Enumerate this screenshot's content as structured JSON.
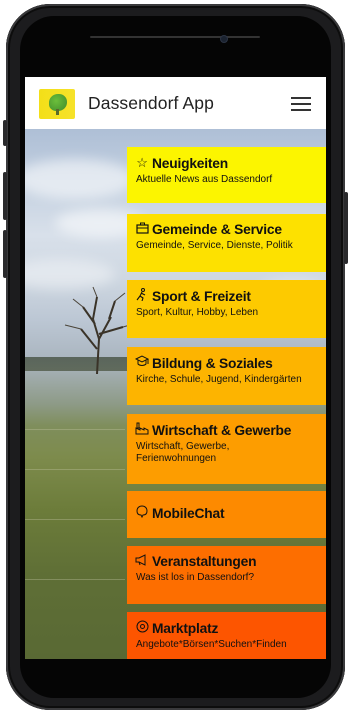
{
  "app": {
    "title": "Dassendorf App"
  },
  "tiles": [
    {
      "title": "Neuigkeiten",
      "subtitle": "Aktuelle News aus Dassendorf",
      "icon": "star-icon",
      "color": "#fcf500"
    },
    {
      "title": "Gemeinde & Service",
      "subtitle": "Gemeinde, Service, Dienste, Politik",
      "icon": "briefcase-icon",
      "color": "#fde100"
    },
    {
      "title": "Sport & Freizeit",
      "subtitle": "Sport, Kultur, Hobby, Leben",
      "icon": "runner-icon",
      "color": "#fdca00"
    },
    {
      "title": "Bildung & Soziales",
      "subtitle": "Kirche, Schule, Jugend, Kindergärten",
      "icon": "graduation-icon",
      "color": "#fdb400"
    },
    {
      "title": "Wirtschaft & Gewerbe",
      "subtitle": "Wirtschaft, Gewerbe, Ferienwohnungen",
      "icon": "factory-icon",
      "color": "#fd9d00"
    },
    {
      "title": "MobileChat",
      "subtitle": "",
      "icon": "chat-icon",
      "color": "#fd8a00"
    },
    {
      "title": "Veranstaltungen",
      "subtitle": "Was ist los in Dassendorf?",
      "icon": "megaphone-icon",
      "color": "#fd6e00"
    },
    {
      "title": "Marktplatz",
      "subtitle": "Angebote*Börsen*Suchen*Finden",
      "icon": "market-icon",
      "color": "#fd5500"
    }
  ]
}
